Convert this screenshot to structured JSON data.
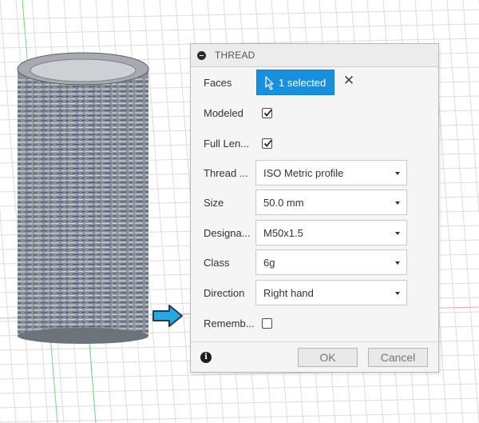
{
  "dialog": {
    "title": "THREAD",
    "fields": {
      "faces_label": "Faces",
      "faces_value": "1 selected",
      "modeled_label": "Modeled",
      "modeled_checked": true,
      "full_length_label": "Full Len...",
      "full_length_checked": true,
      "thread_type_label": "Thread ...",
      "thread_type_value": "ISO Metric profile",
      "size_label": "Size",
      "size_value": "50.0 mm",
      "designation_label": "Designa...",
      "designation_value": "M50x1.5",
      "class_label": "Class",
      "class_value": "6g",
      "direction_label": "Direction",
      "direction_value": "Right hand",
      "remember_label": "Rememb...",
      "remember_checked": false
    },
    "buttons": {
      "ok": "OK",
      "cancel": "Cancel"
    }
  },
  "icons": [
    "collapse-icon",
    "cursor-icon",
    "close-icon",
    "chevron-down-icon",
    "info-icon",
    "arrow-right-icon"
  ],
  "colors": {
    "accent": "#1a8fdc",
    "pointer_arrow": "#2aa6e0",
    "axis_green": "#6fdc7b",
    "axis_red": "#f0a0a0"
  }
}
